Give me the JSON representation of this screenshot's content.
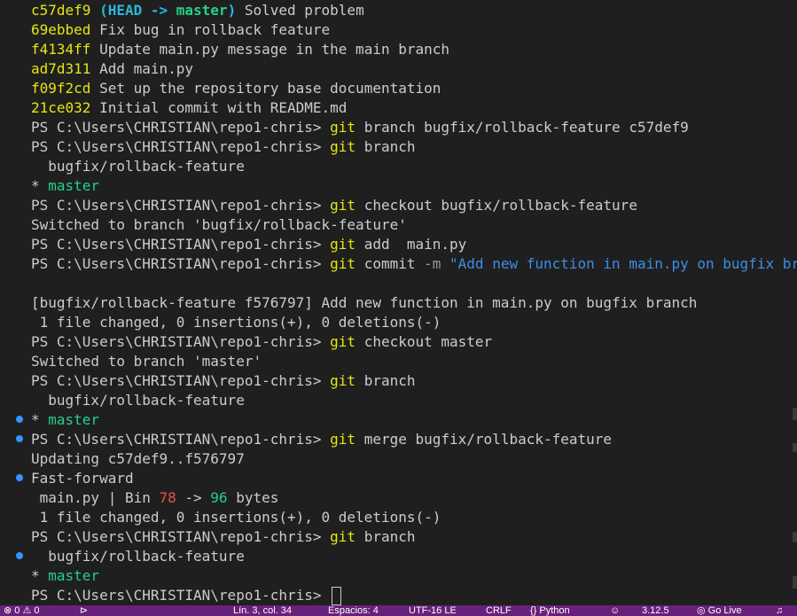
{
  "colors": {
    "background": "#1f1f1f",
    "text": "#cccccc",
    "commit_hash": "#e5e510",
    "git_command": "#e5e510",
    "head_label": "#29b8db",
    "branch_label": "#23d18b",
    "string": "#3b8eea",
    "number_removed": "#f14c4c",
    "number_added": "#23d18b",
    "statusbar": "#68217a",
    "gutter_dot": "#3794ff"
  },
  "log": [
    {
      "hash": "c57def9",
      "open": " (",
      "head": "HEAD -> ",
      "branch": "master",
      "close": ")",
      "message": " Solved problem"
    },
    {
      "hash": "69ebbed",
      "message": " Fix bug in rollback feature"
    },
    {
      "hash": "f4134ff",
      "message": " Update main.py message in the main branch"
    },
    {
      "hash": "ad7d311",
      "message": " Add main.py"
    },
    {
      "hash": "f09f2cd",
      "message": " Set up the repository base documentation"
    },
    {
      "hash": "21ce032",
      "message": " Initial commit with README.md"
    }
  ],
  "prompt": "PS C:\\Users\\CHRISTIAN\\repo1-chris> ",
  "git": "git",
  "cmd1": " branch bugfix/rollback-feature c57def9",
  "cmd2": " branch",
  "out_branch1": "  bugfix/rollback-feature",
  "star": "* ",
  "master": "master",
  "cmd3": " checkout bugfix/rollback-feature",
  "out_switched1": "Switched to branch 'bugfix/rollback-feature'",
  "cmd4": " add  main.py",
  "cmd5_a": " commit ",
  "cmd5_flag": "-m",
  "cmd5_str": " \"Add new function in main.py on bugfix branch\"",
  "out_commit": "[bugfix/rollback-feature f576797] Add new function in main.py on bugfix branch",
  "out_changed": " 1 file changed, 0 insertions(+), 0 deletions(-)",
  "cmd6": " checkout master",
  "out_switched2": "Switched to branch 'master'",
  "cmd7": " branch",
  "out_branch2": "  bugfix/rollback-feature",
  "cmd8": " merge bugfix/rollback-feature",
  "out_updating": "Updating c57def9..f576797",
  "out_ff": "Fast-forward",
  "diffstat_a": " main.py | Bin ",
  "diffstat_old": "78",
  "diffstat_arrow": " -> ",
  "diffstat_new": "96",
  "diffstat_b": " bytes",
  "out_changed2": " 1 file changed, 0 insertions(+), 0 deletions(-)",
  "cmd9": " branch",
  "out_branch3": "  bugfix/rollback-feature",
  "master_plain": "  master",
  "status": {
    "problems": "⊗ 0 ⚠ 0",
    "position": "Lín. 3, col. 34",
    "spaces": "Espacios: 4",
    "encoding": "UTF-16 LE",
    "eol": "CRLF",
    "language": "{} Python",
    "version": "3.12.5",
    "golive": "Go Live"
  }
}
